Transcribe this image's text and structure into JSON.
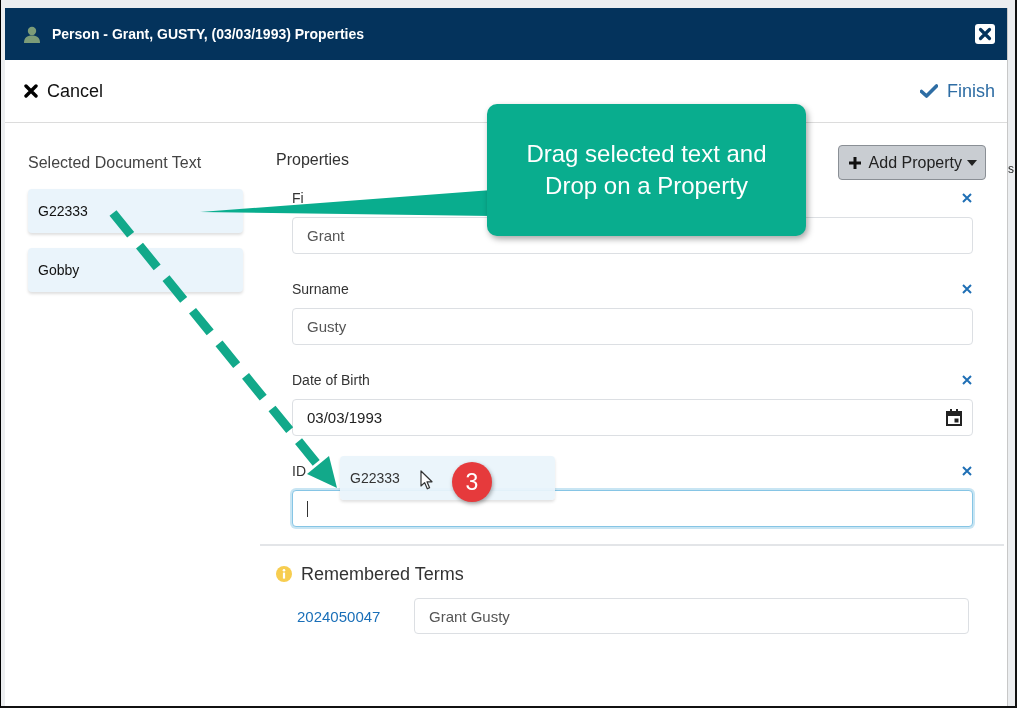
{
  "window": {
    "title": "Person - Grant, GUSTY, (03/03/1993) Properties"
  },
  "toolbar": {
    "cancel": "Cancel",
    "finish": "Finish"
  },
  "selected_document_text": {
    "heading": "Selected Document Text",
    "items": [
      "G22333",
      "Gobby"
    ]
  },
  "properties": {
    "heading": "Properties",
    "add_button": "Add Property",
    "fields": [
      {
        "label": "Fi",
        "kind": "text",
        "value": "Grant",
        "focused": false
      },
      {
        "label": "Surname",
        "kind": "text",
        "value": "Gusty",
        "focused": false
      },
      {
        "label": "Date of Birth",
        "kind": "date",
        "value": "03/03/1993",
        "focused": false
      },
      {
        "label": "ID",
        "kind": "text",
        "focused": true
      }
    ]
  },
  "remembered_terms": {
    "heading": "Remembered Terms",
    "rows": [
      {
        "id": "2024050047",
        "value": "Grant Gusty"
      }
    ]
  },
  "drag_chip": {
    "text": "G22333"
  },
  "step_badge": "3",
  "callout": {
    "text": "Drag selected text and Drop on a Property"
  },
  "background_fragment": "s"
}
